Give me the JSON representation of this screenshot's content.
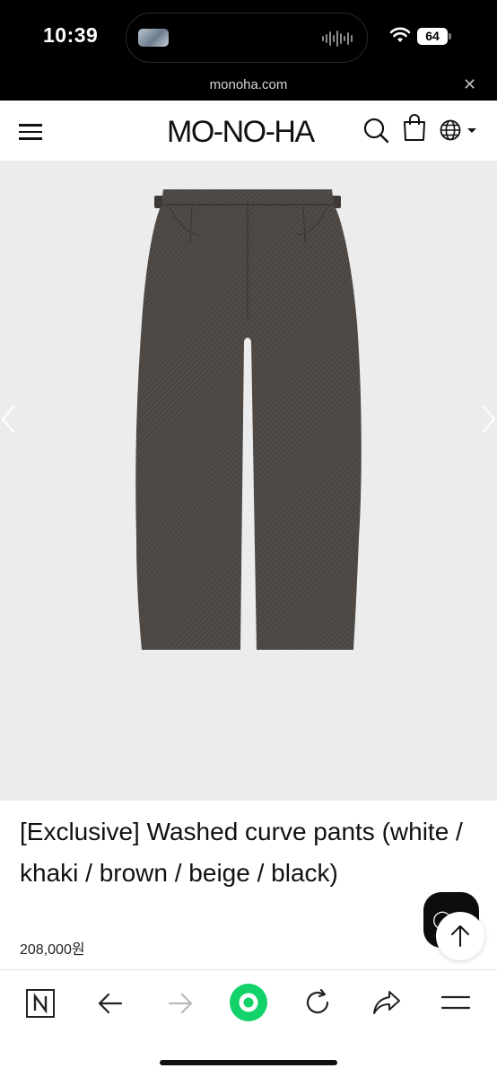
{
  "status_bar": {
    "time": "10:39",
    "battery_level": "64",
    "icons": [
      "music-thumbnail-icon",
      "audio-wave-icon",
      "wifi-icon",
      "battery-icon"
    ]
  },
  "browser": {
    "url": "monoha.com",
    "close_label": "✕"
  },
  "header": {
    "logo": "MO-NO-HA",
    "icons": [
      "menu-icon",
      "search-icon",
      "shopping-bag-icon",
      "globe-icon",
      "chevron-down-icon"
    ]
  },
  "product": {
    "title": "[Exclusive] Washed curve pants (white / khaki / brown / beige / black)",
    "price": "208,000원",
    "image_description_icon": "pants-image"
  },
  "floating": {
    "icons": [
      "chat-icon",
      "arrow-up-icon"
    ]
  },
  "toolbar": {
    "icons": [
      "naver-icon",
      "back-arrow-icon",
      "forward-arrow-icon",
      "green-dot-icon",
      "refresh-icon",
      "share-icon",
      "menu-lines-icon"
    ]
  },
  "colors": {
    "status_bar_bg": "#000000",
    "image_bg": "#ececec",
    "pants": "#4b4642",
    "green_button": "#14d26a"
  }
}
